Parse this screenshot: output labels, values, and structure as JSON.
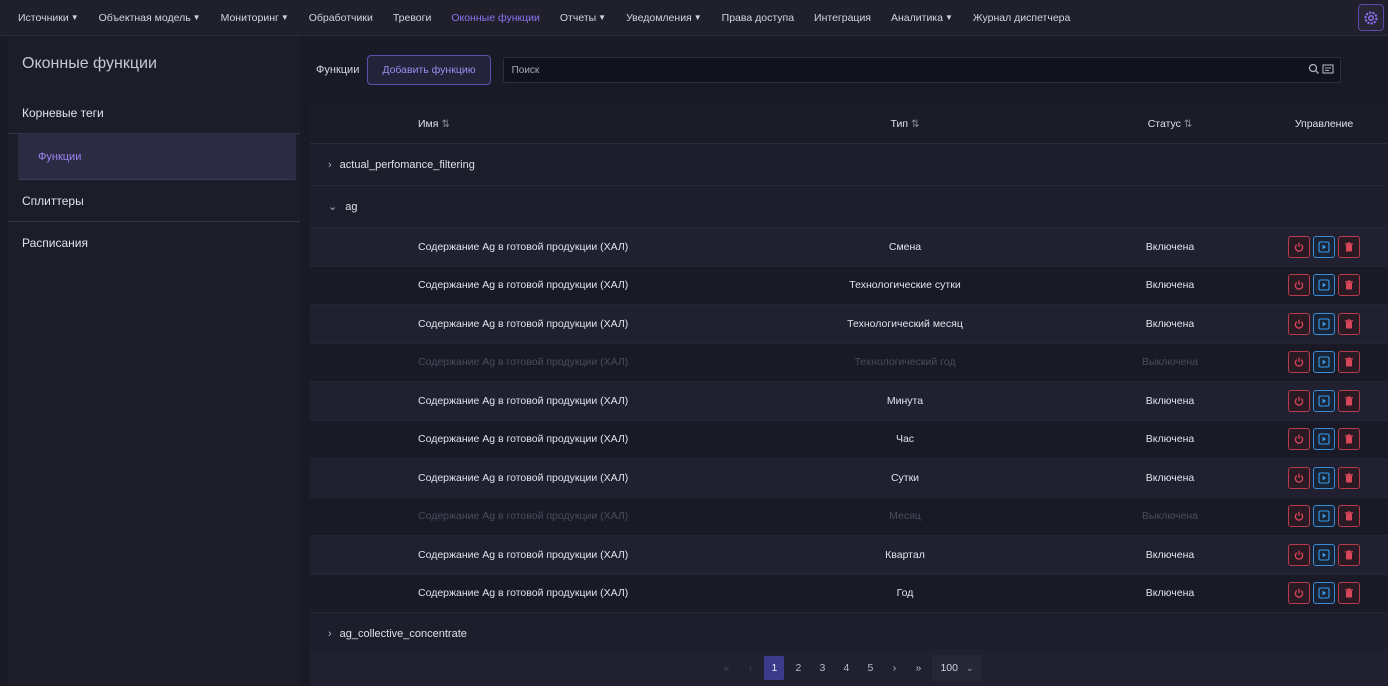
{
  "nav": {
    "items": [
      {
        "label": "Источники",
        "dropdown": true
      },
      {
        "label": "Объектная модель",
        "dropdown": true
      },
      {
        "label": "Мониторинг",
        "dropdown": true
      },
      {
        "label": "Обработчики",
        "dropdown": false
      },
      {
        "label": "Тревоги",
        "dropdown": false
      },
      {
        "label": "Оконные функции",
        "dropdown": false,
        "active": true
      },
      {
        "label": "Отчеты",
        "dropdown": true
      },
      {
        "label": "Уведомления",
        "dropdown": true
      },
      {
        "label": "Права доступа",
        "dropdown": false
      },
      {
        "label": "Интеграция",
        "dropdown": false
      },
      {
        "label": "Аналитика",
        "dropdown": true
      },
      {
        "label": "Журнал диспетчера",
        "dropdown": false
      }
    ]
  },
  "sidebar": {
    "title": "Оконные функции",
    "items": [
      {
        "label": "Корневые теги"
      },
      {
        "label": "Функции"
      },
      {
        "label": "Сплиттеры"
      },
      {
        "label": "Расписания"
      }
    ]
  },
  "toolbar": {
    "label": "Функции",
    "add_label": "Добавить функцию",
    "search_placeholder": "Поиск"
  },
  "table": {
    "headers": {
      "name": "Имя",
      "type": "Тип",
      "status": "Статус",
      "control": "Управление"
    },
    "groups": [
      {
        "name": "actual_perfomance_filtering",
        "expanded": false
      },
      {
        "name": "ag",
        "expanded": true
      },
      {
        "name": "ag_collective_concentrate",
        "expanded": false
      }
    ],
    "rows": [
      {
        "name": "Содержание Ag в готовой продукции (ХАЛ)",
        "type": "Смена",
        "status": "Включена",
        "enabled": true
      },
      {
        "name": "Содержание Ag в готовой продукции (ХАЛ)",
        "type": "Технологические сутки",
        "status": "Включена",
        "enabled": true
      },
      {
        "name": "Содержание Ag в готовой продукции (ХАЛ)",
        "type": "Технологический месяц",
        "status": "Включена",
        "enabled": true
      },
      {
        "name": "Содержание Ag в готовой продукции (ХАЛ)",
        "type": "Технологический год",
        "status": "Выключена",
        "enabled": false
      },
      {
        "name": "Содержание Ag в готовой продукции (ХАЛ)",
        "type": "Минута",
        "status": "Включена",
        "enabled": true
      },
      {
        "name": "Содержание Ag в готовой продукции (ХАЛ)",
        "type": "Час",
        "status": "Включена",
        "enabled": true
      },
      {
        "name": "Содержание Ag в готовой продукции (ХАЛ)",
        "type": "Сутки",
        "status": "Включена",
        "enabled": true
      },
      {
        "name": "Содержание Ag в готовой продукции (ХАЛ)",
        "type": "Месяц",
        "status": "Выключена",
        "enabled": false
      },
      {
        "name": "Содержание Ag в готовой продукции (ХАЛ)",
        "type": "Квартал",
        "status": "Включена",
        "enabled": true
      },
      {
        "name": "Содержание Ag в готовой продукции (ХАЛ)",
        "type": "Год",
        "status": "Включена",
        "enabled": true
      }
    ]
  },
  "pagination": {
    "pages": [
      "1",
      "2",
      "3",
      "4",
      "5"
    ],
    "current": "1",
    "page_size": "100"
  },
  "colors": {
    "accent": "#8e72f0",
    "power": "#d8465a",
    "play": "#3a9ae8",
    "delete": "#d8465a"
  }
}
